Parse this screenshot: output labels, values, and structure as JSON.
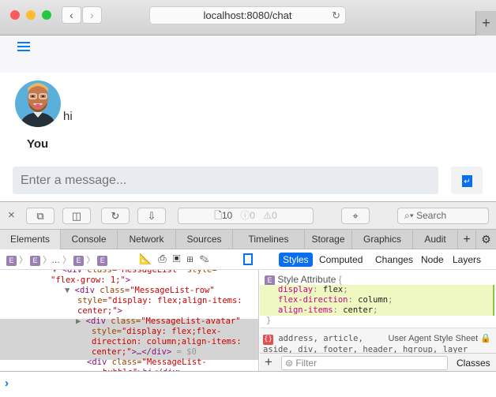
{
  "browser": {
    "url": "localhost:8080/chat",
    "back_icon": "chevron-left-icon",
    "forward_icon": "chevron-right-icon",
    "reload_icon": "reload-icon",
    "new_tab_icon": "plus-icon"
  },
  "app": {
    "menu_icon": "hamburger-icon",
    "accent": "#007bff",
    "message": {
      "text": "hi",
      "author": "You"
    },
    "input": {
      "placeholder": "Enter a message...",
      "value": ""
    },
    "send_icon": "enter-icon"
  },
  "devtools": {
    "resource_count": "10",
    "error_count": "0",
    "warning_count": "0",
    "search_placeholder": "Search",
    "tabs": [
      "Elements",
      "Console",
      "Network",
      "Sources",
      "Timelines",
      "Storage",
      "Graphics",
      "Audit"
    ],
    "selected_tab": "Elements",
    "breadcrumb": [
      "E",
      "E",
      "…",
      "E",
      "E"
    ],
    "sidebar_tabs": [
      "Styles",
      "Computed",
      "Changes",
      "Node",
      "Layers"
    ],
    "dom_lines": [
      {
        "tri": "▼",
        "parts": [
          [
            "tag",
            "<div "
          ],
          [
            "attr",
            "class="
          ],
          [
            "val",
            "\"MessageList\" "
          ],
          [
            "attr",
            "style="
          ]
        ]
      },
      {
        "tri": "",
        "parts": [
          [
            "val",
            "\"flex-grow: 1;\""
          ],
          [
            "tag",
            ">"
          ]
        ]
      },
      {
        "tri": "▼",
        "parts": [
          [
            "tag",
            "<div "
          ],
          [
            "attr",
            "class="
          ],
          [
            "val",
            "\"MessageList-row\""
          ]
        ]
      },
      {
        "tri": "",
        "parts": [
          [
            "attr",
            "style="
          ],
          [
            "val",
            "\"display: flex;align-items:"
          ]
        ]
      },
      {
        "tri": "",
        "parts": [
          [
            "val",
            "center;\""
          ],
          [
            "tag",
            ">"
          ]
        ]
      },
      {
        "tri": "▶",
        "parts": [
          [
            "tag",
            "<div "
          ],
          [
            "attr",
            "class="
          ],
          [
            "val",
            "\"MessageList-avatar\""
          ]
        ]
      },
      {
        "tri": "",
        "parts": [
          [
            "attr",
            "style="
          ],
          [
            "val",
            "\"display: flex;flex-"
          ]
        ]
      },
      {
        "tri": "",
        "parts": [
          [
            "val",
            "direction: column;align-items:"
          ]
        ]
      },
      {
        "tri": "",
        "parts": [
          [
            "val",
            "center;\""
          ],
          [
            "tag",
            ">…</div>"
          ],
          [
            "gray",
            " = $0"
          ]
        ]
      },
      {
        "tri": "",
        "parts": [
          [
            "tag",
            "<div "
          ],
          [
            "attr",
            "class="
          ],
          [
            "val",
            "\"MessageList-"
          ]
        ]
      },
      {
        "tri": "",
        "parts": [
          [
            "val",
            "bubble\""
          ],
          [
            "tag",
            ">hi</div>"
          ]
        ]
      }
    ],
    "style_rule": {
      "label": "Style Attribute",
      "open": "{",
      "close": "}",
      "props": [
        [
          "display",
          "flex"
        ],
        [
          "flex-direction",
          "column"
        ],
        [
          "align-items",
          "center"
        ]
      ]
    },
    "ua_rule": {
      "selector": "address, article,",
      "selector_2": "aside, div, footer, header, hgroup, layer",
      "origin": "User Agent Style Sheet"
    },
    "filter_placeholder": "Filter",
    "classes_label": "Classes",
    "prompt": "›"
  }
}
